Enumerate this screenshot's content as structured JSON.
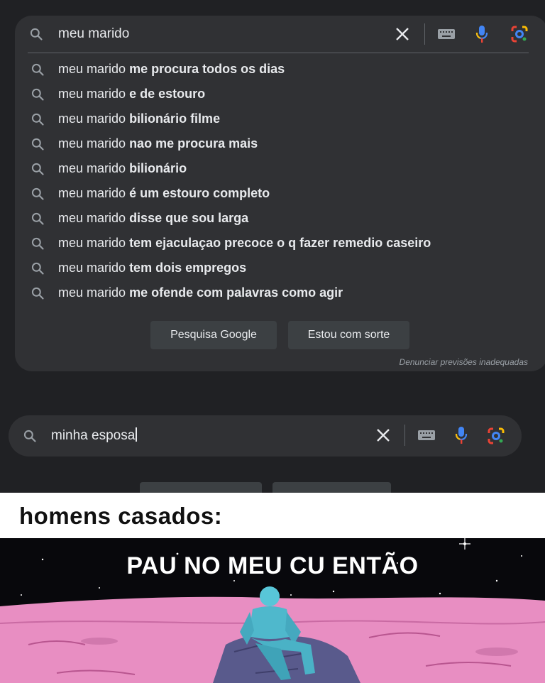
{
  "search_panel": {
    "query": "meu marido",
    "suggestions": [
      {
        "prefix": "meu marido",
        "suffix": "me procura todos os dias"
      },
      {
        "prefix": "meu marido",
        "suffix": "e de estouro"
      },
      {
        "prefix": "meu marido",
        "suffix": "bilionário filme"
      },
      {
        "prefix": "meu marido",
        "suffix": "nao me procura mais"
      },
      {
        "prefix": "meu marido",
        "suffix": "bilionário"
      },
      {
        "prefix": "meu marido",
        "suffix": "é um estouro completo"
      },
      {
        "prefix": "meu marido",
        "suffix": "disse que sou larga"
      },
      {
        "prefix": "meu marido",
        "suffix": "tem ejaculaçao precoce o q fazer remedio caseiro"
      },
      {
        "prefix": "meu marido",
        "suffix": "tem dois empregos"
      },
      {
        "prefix": "meu marido",
        "suffix": "me ofende com palavras como agir"
      }
    ],
    "search_button": "Pesquisa Google",
    "lucky_button": "Estou com sorte",
    "report_link": "Denunciar previsões inadequadas"
  },
  "search_bar_2": {
    "query": "minha esposa"
  },
  "meme": {
    "caption": "homens casados:",
    "image_text": "PAU NO MEU CU ENTÃO"
  },
  "colors": {
    "background": "#202124",
    "panel": "#303134",
    "text": "#e8eaed",
    "button": "#3c4043",
    "mic_blue": "#4285f4",
    "mic_red": "#ea4335",
    "lens_yellow": "#fbbc04",
    "lens_green": "#34a853",
    "ground_pink": "#e88ec2"
  },
  "icons": [
    "search-icon",
    "close-icon",
    "keyboard-icon",
    "microphone-icon",
    "google-lens-icon"
  ]
}
